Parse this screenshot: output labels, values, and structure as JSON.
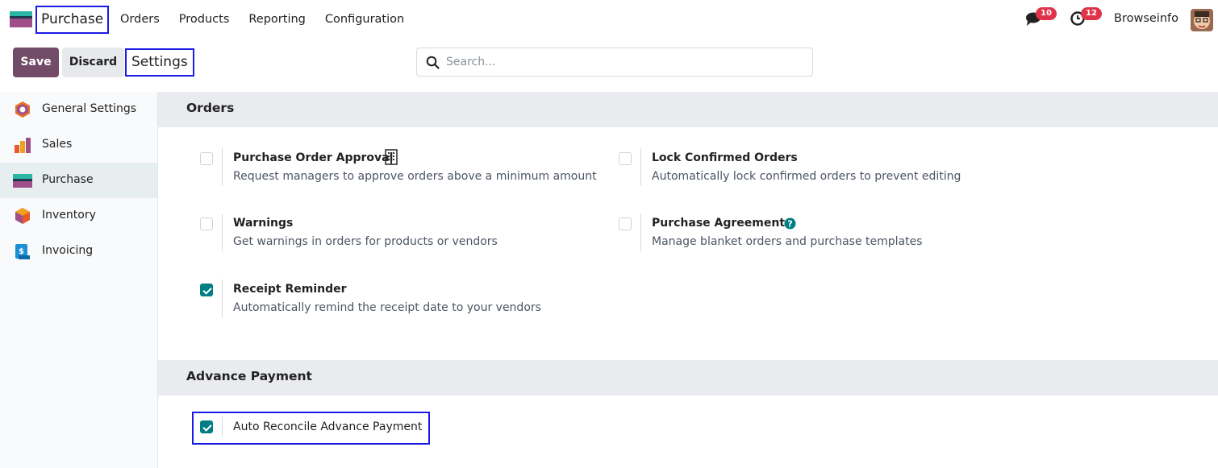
{
  "navbar": {
    "app_name": "Purchase",
    "menu": [
      "Orders",
      "Products",
      "Reporting",
      "Configuration"
    ],
    "messages_count": "10",
    "activities_count": "12",
    "user_name": "Browseinfo"
  },
  "control_panel": {
    "save_label": "Save",
    "discard_label": "Discard",
    "breadcrumb": "Settings",
    "search_placeholder": "Search..."
  },
  "sidebar": {
    "items": [
      {
        "label": "General Settings",
        "icon": "general-settings-icon"
      },
      {
        "label": "Sales",
        "icon": "sales-icon"
      },
      {
        "label": "Purchase",
        "icon": "purchase-icon",
        "active": true
      },
      {
        "label": "Inventory",
        "icon": "inventory-icon"
      },
      {
        "label": "Invoicing",
        "icon": "invoicing-icon"
      }
    ]
  },
  "sections": {
    "orders": {
      "title": "Orders",
      "settings": {
        "purchase_order_approval": {
          "title": "Purchase Order Approval",
          "desc": "Request managers to approve orders above a minimum amount",
          "checked": false
        },
        "lock_confirmed_orders": {
          "title": "Lock Confirmed Orders",
          "desc": "Automatically lock confirmed orders to prevent editing",
          "checked": false
        },
        "warnings": {
          "title": "Warnings",
          "desc": "Get warnings in orders for products or vendors",
          "checked": false
        },
        "purchase_agreements": {
          "title": "Purchase Agreements",
          "desc": "Manage blanket orders and purchase templates",
          "checked": false
        },
        "receipt_reminder": {
          "title": "Receipt Reminder",
          "desc": "Automatically remind the receipt date to your vendors",
          "checked": true
        }
      }
    },
    "advance_payment": {
      "title": "Advance Payment",
      "settings": {
        "auto_reconcile": {
          "title": "Auto Reconcile Advance Payment",
          "checked": true
        }
      }
    }
  },
  "colors": {
    "brand": "#714b67",
    "check": "#017e84",
    "badge": "#e0334b",
    "highlight": "#1a1ae6"
  }
}
